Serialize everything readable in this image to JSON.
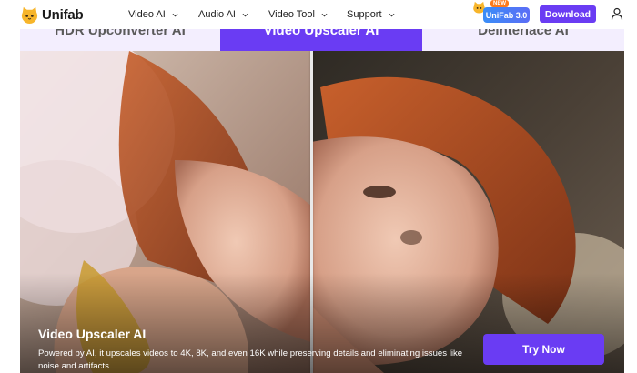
{
  "nav": {
    "logo_text": "Unifab",
    "menu": [
      {
        "label": "Video AI"
      },
      {
        "label": "Audio AI"
      },
      {
        "label": "Video Tool"
      },
      {
        "label": "Support"
      }
    ],
    "new_tag": "NEW",
    "version_badge": "UniFab 3.0",
    "download_label": "Download"
  },
  "tabs": [
    {
      "label": "HDR Upconverter AI",
      "active": false
    },
    {
      "label": "Video Upscaler AI",
      "active": true
    },
    {
      "label": "Deinterlace AI",
      "active": false
    }
  ],
  "hero": {
    "title": "Video Upscaler AI",
    "description": "Powered by AI, it upscales videos to 4K, 8K, and even 16K while preserving details and eliminating issues like noise and artifacts.",
    "cta_label": "Try Now"
  },
  "colors": {
    "brand_purple": "#6a3cf3",
    "tab_inactive_bg": "#f3eefe",
    "badge_blue": "#3a8df7",
    "new_tag_orange": "#ff7a1a"
  },
  "icons": {
    "logo": "cat-logo-icon",
    "chevron": "chevron-down-icon",
    "mascot": "cat-mascot-icon",
    "user": "user-icon"
  }
}
